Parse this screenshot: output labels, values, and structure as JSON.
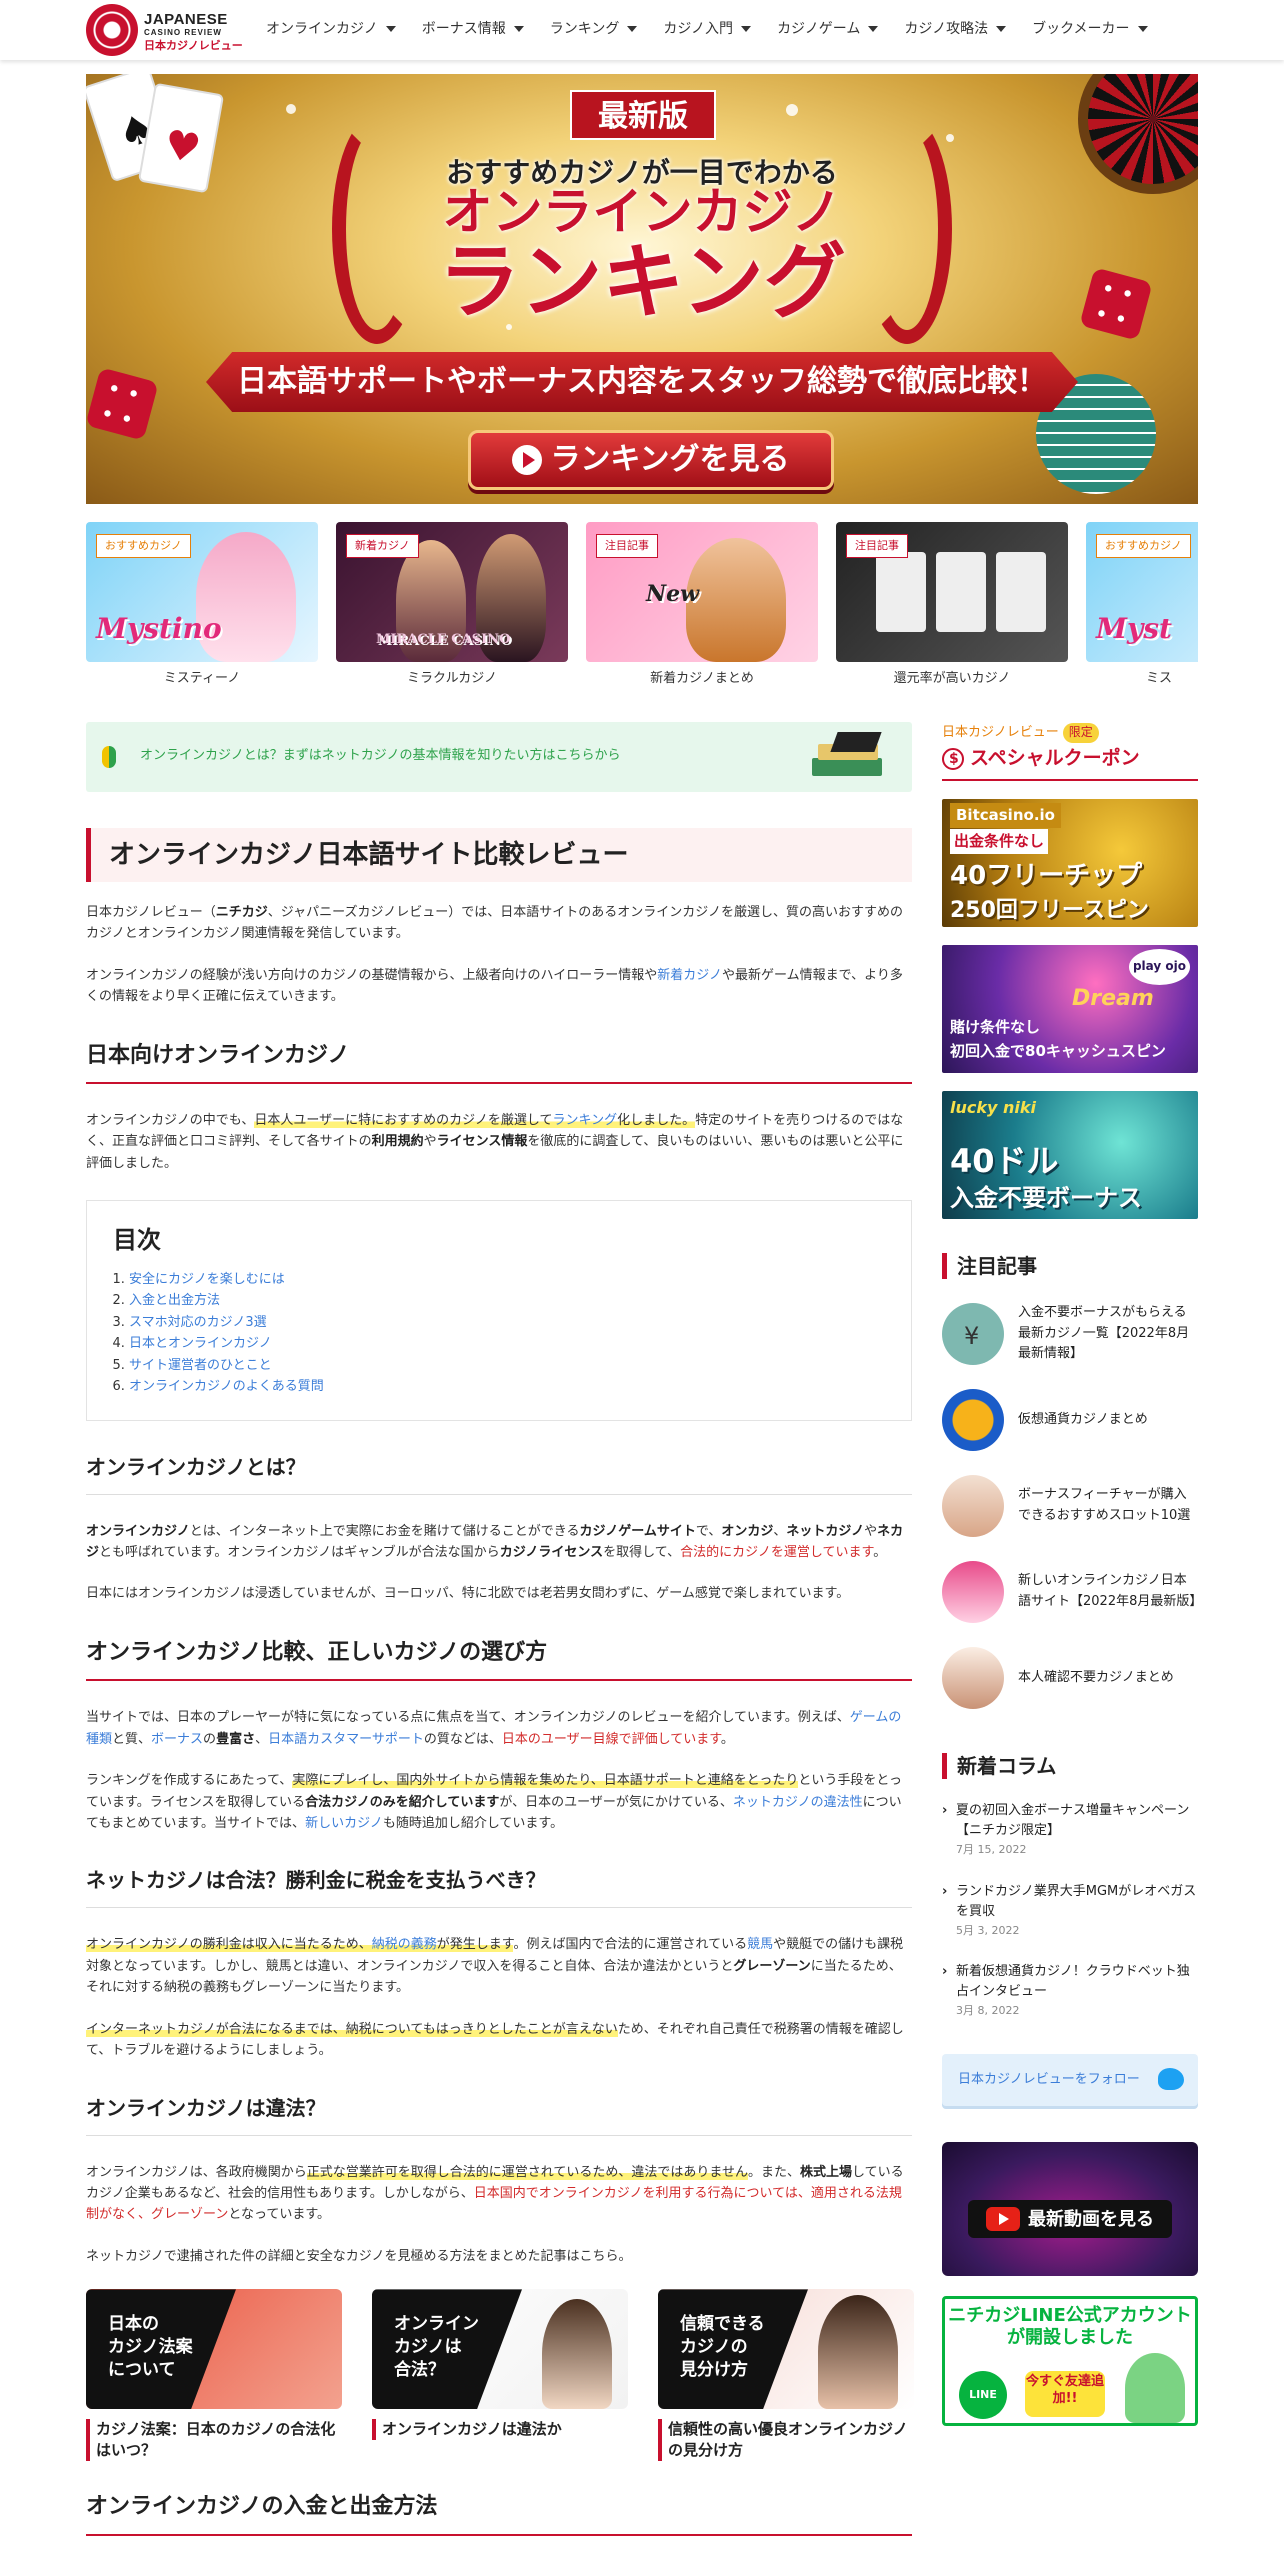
{
  "header": {
    "logo": {
      "line1": "JAPANESE",
      "line2": "CASINO REVIEW",
      "line3": "日本カジノレビュー"
    },
    "nav": [
      "オンラインカジノ",
      "ボーナス情報",
      "ランキング",
      "カジノ入門",
      "カジノゲーム",
      "カジノ攻略法",
      "ブックメーカー"
    ]
  },
  "hero": {
    "badge": "最新版",
    "subtitle": "おすすめカジノが一目でわかる",
    "title1": "オンラインカジノ",
    "title2": "ランキング",
    "ribbon": "日本語サポートやボーナス内容をスタッフ総勢で徹底比較！",
    "cta": "ランキングを見る"
  },
  "carousel": [
    {
      "tag": "おすすめカジノ",
      "logo": "Mystino",
      "caption": "ミスティーノ"
    },
    {
      "tag": "新着カジノ",
      "logo": "MIRACLE CASINO",
      "caption": "ミラクルカジノ"
    },
    {
      "tag": "注目記事",
      "logo": "New",
      "caption": "新着カジノまとめ"
    },
    {
      "tag": "注目記事",
      "logo": "",
      "caption": "還元率が高いカジノ"
    },
    {
      "tag": "おすすめカジノ",
      "logo": "Myst",
      "caption": "ミス"
    }
  ],
  "main": {
    "beginner": "オンラインカジノとは？まずはネットカジノの基本情報を知りたい方はこちらから",
    "h_review": "オンラインカジノ日本語サイト比較レビュー",
    "intro1_a": "日本カジノレビュー（",
    "intro1_b": "ニチカジ",
    "intro1_c": "、ジャパニーズカジノレビュー）では、日本語サイトのあるオンラインカジノを厳選し、質の高いおすすめのカジノとオンラインカジノ関連情報を発信しています。",
    "intro2_a": "オンラインカジノの経験が浅い方向けのカジノの基礎情報から、上級者向けのハイローラー情報や",
    "intro2_link": "新着カジノ",
    "intro2_c": "や最新ゲーム情報まで、より多くの情報をより早く正確に伝えていきます。",
    "h_japan": "日本向けオンラインカジノ",
    "japan_a": "オンラインカジノの中でも、",
    "japan_hl": "日本人ユーザーに特におすすめのカジノを厳選して",
    "japan_link": "ランキング",
    "japan_hl2": "化しました。",
    "japan_b": "特定のサイトを売りつけるのではなく、正直な評価と口コミ評判、そして各サイトの",
    "japan_bold1": "利用規約",
    "japan_c": "や",
    "japan_bold2": "ライセンス情報",
    "japan_d": "を徹底的に調査して、良いものはいい、悪いものは悪いと公平に評価しました。",
    "toc_title": "目次",
    "toc": [
      "安全にカジノを楽しむには",
      "入金と出金方法",
      "スマホ対応のカジノ3選",
      "日本とオンラインカジノ",
      "サイト運営者のひとこと",
      "オンラインカジノのよくある質問"
    ],
    "h_what": "オンラインカジノとは？",
    "what1_b1": "オンラインカジノ",
    "what1_a": "とは、インターネット上で実際にお金を賭けて儲けることができる",
    "what1_b2": "カジノゲームサイト",
    "what1_c": "で、",
    "what1_b3": "オンカジ",
    "what1_d": "、",
    "what1_b4": "ネットカジノ",
    "what1_e": "や",
    "what1_b5": "ネカジ",
    "what1_f": "とも呼ばれています。オンラインカジノはギャンブルが合法な国から",
    "what1_b6": "カジノライセンス",
    "what1_g": "を取得して、",
    "what1_red": "合法的にカジノを運営しています",
    "what1_h": "。",
    "what2": "日本にはオンラインカジノは浸透していませんが、ヨーロッパ、特に北欧では老若男女問わずに、ゲーム感覚で楽しまれています。",
    "h_choose": "オンラインカジノ比較、正しいカジノの選び方",
    "choose1_a": "当サイトでは、日本のプレーヤーが特に気になっている点に焦点を当て、オンラインカジノのレビューを紹介しています。例えば、",
    "choose1_l1": "ゲームの種類",
    "choose1_b": "と質、",
    "choose1_l2": "ボーナス",
    "choose1_c": "の",
    "choose1_bold": "豊富さ",
    "choose1_d": "、",
    "choose1_l3": "日本語カスタマーサポート",
    "choose1_e": "の質などは、",
    "choose1_red": "日本のユーザー目線で評価しています",
    "choose1_f": "。",
    "choose2_a": "ランキングを作成するにあたって、",
    "choose2_hl": "実際にプレイし、国内外サイトから情報を集めたり、日本語サポートと連絡をとったり",
    "choose2_b": "という手段をとっています。ライセンスを取得している",
    "choose2_bold": "合法カジノのみを紹介しています",
    "choose2_c": "が、日本のユーザーが気にかけている、",
    "choose2_l1": "ネットカジノの違法性",
    "choose2_d": "についてもまとめています。当サイトでは、",
    "choose2_l2": "新しいカジノ",
    "choose2_e": "も随時追加し紹介しています。",
    "h_tax": "ネットカジノは合法？勝利金に税金を支払うべき？",
    "tax1_hl": "オンラインカジノの勝利金は収入に当たるため、",
    "tax1_hlblue": "納税の義務",
    "tax1_hl2": "が発生します",
    "tax1_a": "。例えば国内で合法的に運営されている",
    "tax1_l1": "競馬",
    "tax1_b": "や競艇での儲けも課税対象となっています。しかし、競馬とは違い、オンラインカジノで収入を得ること自体、合法か違法かというと",
    "tax1_bold": "グレーゾーン",
    "tax1_c": "に当たるため、それに対する納税の義務もグレーゾーンに当たります。",
    "tax2_hl": "インターネットカジノが合法になるまでは、納税についてもはっきりとしたことが言えない",
    "tax2_a": "ため、それぞれ自己責任で税務署の情報を確認して、トラブルを避けるようにしましょう。",
    "h_illegal": "オンラインカジノは違法？",
    "ill1_a": "オンラインカジノは、各政府機関から",
    "ill1_hl": "正式な営業許可を取得し合法的に運営されているため、違法ではありません",
    "ill1_b": "。また、",
    "ill1_bold": "株式上場",
    "ill1_c": "しているカジノ企業もあるなど、社会的信用性もあります。しかしながら、",
    "ill1_red": "日本国内でオンラインカジノを利用する行為については、適用される法規制がなく、グレーゾーン",
    "ill1_d": "となっています。",
    "ill2": "ネットカジノで逮捕された件の詳細と安全なカジノを見極める方法をまとめた記事はこちら。",
    "cards": [
      {
        "img": "日本の\nカジノ法案\nについて",
        "caption": "カジノ法案：日本のカジノの合法化はいつ？"
      },
      {
        "img": "オンライン\nカジノは\n合法？",
        "caption": "オンラインカジノは違法か"
      },
      {
        "img": "信頼できる\nカジノの\n見分け方",
        "caption": "信頼性の高い優良オンラインカジノの見分け方"
      }
    ],
    "h_deposit": "オンラインカジノの入金と出金方法"
  },
  "sidebar": {
    "sp_label": "日本カジノレビュー",
    "sp_pill": "限定",
    "sp_title": "スペシャルクーポン",
    "ads": [
      {
        "l1": "Bitcasino.io",
        "l2": "出金条件なし",
        "l3": "40フリーチップ",
        "l4": "250回フリースピン"
      },
      {
        "l1": "play ojo",
        "l2": "賭け条件なし",
        "l3": "初回入金で80キャッシュスピン",
        "l4": "Dream"
      },
      {
        "l1": "lucky niki",
        "l2": "40ドル",
        "l3": "入金不要ボーナス",
        "l4": ""
      }
    ],
    "featured_title": "注目記事",
    "featured": [
      "入金不要ボーナスがもらえる最新カジノ一覧【2022年8月最新情報】",
      "仮想通貨カジノまとめ",
      "ボーナスフィーチャーが購入できるおすすめスロット10選",
      "新しいオンラインカジノ日本語サイト【2022年8月最新版】",
      "本人確認不要カジノまとめ"
    ],
    "column_title": "新着コラム",
    "columns": [
      {
        "title": "夏の初回入金ボーナス増量キャンペーン【ニチカジ限定】",
        "date": "7月 15, 2022"
      },
      {
        "title": "ランドカジノ業界大手MGMがレオベガスを買収",
        "date": "5月 3, 2022"
      },
      {
        "title": "新着仮想通貨カジノ！クラウドベット独占インタビュー",
        "date": "3月 8, 2022"
      }
    ],
    "follow": "日本カジノレビューをフォロー",
    "youtube": "最新動画を見る",
    "line_head": "ニチカジLINE公式アカウントが開設しました",
    "line_circle": "LINE",
    "line_now": "今すぐ友達追加!!"
  }
}
